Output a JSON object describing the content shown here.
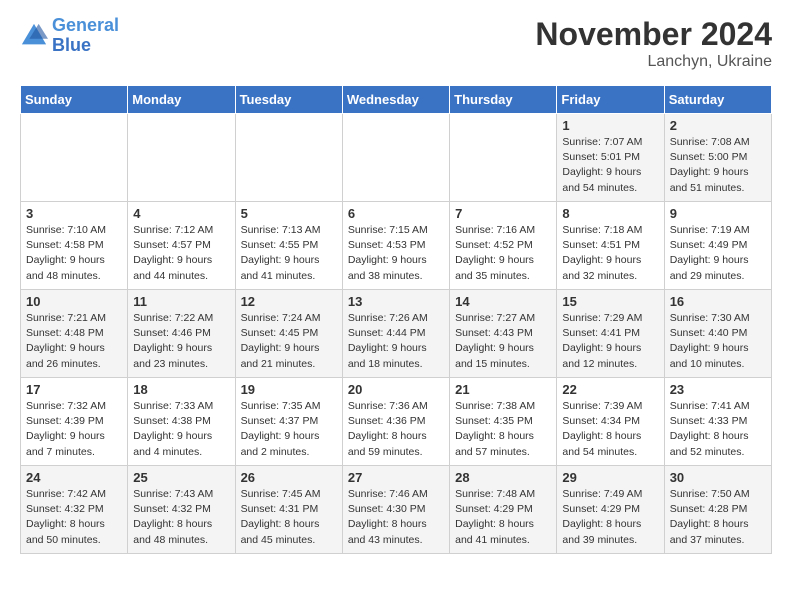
{
  "logo": {
    "line1": "General",
    "line2": "Blue"
  },
  "title": "November 2024",
  "subtitle": "Lanchyn, Ukraine",
  "days_header": [
    "Sunday",
    "Monday",
    "Tuesday",
    "Wednesday",
    "Thursday",
    "Friday",
    "Saturday"
  ],
  "weeks": [
    [
      {
        "day": "",
        "info": ""
      },
      {
        "day": "",
        "info": ""
      },
      {
        "day": "",
        "info": ""
      },
      {
        "day": "",
        "info": ""
      },
      {
        "day": "",
        "info": ""
      },
      {
        "day": "1",
        "info": "Sunrise: 7:07 AM\nSunset: 5:01 PM\nDaylight: 9 hours\nand 54 minutes."
      },
      {
        "day": "2",
        "info": "Sunrise: 7:08 AM\nSunset: 5:00 PM\nDaylight: 9 hours\nand 51 minutes."
      }
    ],
    [
      {
        "day": "3",
        "info": "Sunrise: 7:10 AM\nSunset: 4:58 PM\nDaylight: 9 hours\nand 48 minutes."
      },
      {
        "day": "4",
        "info": "Sunrise: 7:12 AM\nSunset: 4:57 PM\nDaylight: 9 hours\nand 44 minutes."
      },
      {
        "day": "5",
        "info": "Sunrise: 7:13 AM\nSunset: 4:55 PM\nDaylight: 9 hours\nand 41 minutes."
      },
      {
        "day": "6",
        "info": "Sunrise: 7:15 AM\nSunset: 4:53 PM\nDaylight: 9 hours\nand 38 minutes."
      },
      {
        "day": "7",
        "info": "Sunrise: 7:16 AM\nSunset: 4:52 PM\nDaylight: 9 hours\nand 35 minutes."
      },
      {
        "day": "8",
        "info": "Sunrise: 7:18 AM\nSunset: 4:51 PM\nDaylight: 9 hours\nand 32 minutes."
      },
      {
        "day": "9",
        "info": "Sunrise: 7:19 AM\nSunset: 4:49 PM\nDaylight: 9 hours\nand 29 minutes."
      }
    ],
    [
      {
        "day": "10",
        "info": "Sunrise: 7:21 AM\nSunset: 4:48 PM\nDaylight: 9 hours\nand 26 minutes."
      },
      {
        "day": "11",
        "info": "Sunrise: 7:22 AM\nSunset: 4:46 PM\nDaylight: 9 hours\nand 23 minutes."
      },
      {
        "day": "12",
        "info": "Sunrise: 7:24 AM\nSunset: 4:45 PM\nDaylight: 9 hours\nand 21 minutes."
      },
      {
        "day": "13",
        "info": "Sunrise: 7:26 AM\nSunset: 4:44 PM\nDaylight: 9 hours\nand 18 minutes."
      },
      {
        "day": "14",
        "info": "Sunrise: 7:27 AM\nSunset: 4:43 PM\nDaylight: 9 hours\nand 15 minutes."
      },
      {
        "day": "15",
        "info": "Sunrise: 7:29 AM\nSunset: 4:41 PM\nDaylight: 9 hours\nand 12 minutes."
      },
      {
        "day": "16",
        "info": "Sunrise: 7:30 AM\nSunset: 4:40 PM\nDaylight: 9 hours\nand 10 minutes."
      }
    ],
    [
      {
        "day": "17",
        "info": "Sunrise: 7:32 AM\nSunset: 4:39 PM\nDaylight: 9 hours\nand 7 minutes."
      },
      {
        "day": "18",
        "info": "Sunrise: 7:33 AM\nSunset: 4:38 PM\nDaylight: 9 hours\nand 4 minutes."
      },
      {
        "day": "19",
        "info": "Sunrise: 7:35 AM\nSunset: 4:37 PM\nDaylight: 9 hours\nand 2 minutes."
      },
      {
        "day": "20",
        "info": "Sunrise: 7:36 AM\nSunset: 4:36 PM\nDaylight: 8 hours\nand 59 minutes."
      },
      {
        "day": "21",
        "info": "Sunrise: 7:38 AM\nSunset: 4:35 PM\nDaylight: 8 hours\nand 57 minutes."
      },
      {
        "day": "22",
        "info": "Sunrise: 7:39 AM\nSunset: 4:34 PM\nDaylight: 8 hours\nand 54 minutes."
      },
      {
        "day": "23",
        "info": "Sunrise: 7:41 AM\nSunset: 4:33 PM\nDaylight: 8 hours\nand 52 minutes."
      }
    ],
    [
      {
        "day": "24",
        "info": "Sunrise: 7:42 AM\nSunset: 4:32 PM\nDaylight: 8 hours\nand 50 minutes."
      },
      {
        "day": "25",
        "info": "Sunrise: 7:43 AM\nSunset: 4:32 PM\nDaylight: 8 hours\nand 48 minutes."
      },
      {
        "day": "26",
        "info": "Sunrise: 7:45 AM\nSunset: 4:31 PM\nDaylight: 8 hours\nand 45 minutes."
      },
      {
        "day": "27",
        "info": "Sunrise: 7:46 AM\nSunset: 4:30 PM\nDaylight: 8 hours\nand 43 minutes."
      },
      {
        "day": "28",
        "info": "Sunrise: 7:48 AM\nSunset: 4:29 PM\nDaylight: 8 hours\nand 41 minutes."
      },
      {
        "day": "29",
        "info": "Sunrise: 7:49 AM\nSunset: 4:29 PM\nDaylight: 8 hours\nand 39 minutes."
      },
      {
        "day": "30",
        "info": "Sunrise: 7:50 AM\nSunset: 4:28 PM\nDaylight: 8 hours\nand 37 minutes."
      }
    ]
  ]
}
